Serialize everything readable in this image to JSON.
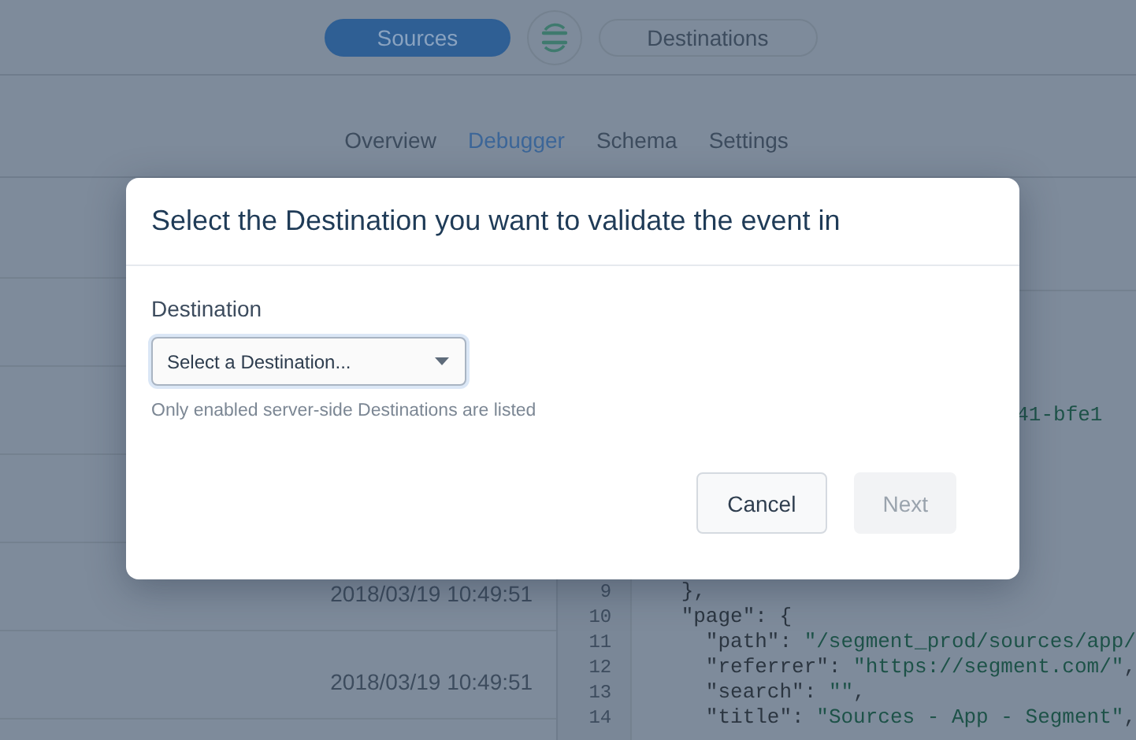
{
  "top_nav": [
    {
      "label": "Sources",
      "selected": true
    },
    {
      "label": "Destinations",
      "selected": false
    }
  ],
  "tabs": [
    {
      "label": "Overview",
      "selected": false
    },
    {
      "label": "Debugger",
      "selected": true
    },
    {
      "label": "Schema",
      "selected": false
    },
    {
      "label": "Settings",
      "selected": false
    }
  ],
  "events": [
    {
      "time": "2018/03/19 10:49:51"
    },
    {
      "time": "2018/03/19 10:49:51"
    }
  ],
  "code": {
    "fragment": "41-bfe1",
    "lines": [
      {
        "number": "9",
        "parts": [
          {
            "kind": "punct",
            "text": "    },"
          }
        ]
      },
      {
        "number": "10",
        "parts": [
          {
            "kind": "key",
            "text": "    \"page\": {"
          }
        ]
      },
      {
        "number": "11",
        "parts": [
          {
            "kind": "key",
            "text": "      \"path\": "
          },
          {
            "kind": "string",
            "text": "\"/segment_prod/sources/app/"
          }
        ]
      },
      {
        "number": "12",
        "parts": [
          {
            "kind": "key",
            "text": "      \"referrer\": "
          },
          {
            "kind": "string",
            "text": "\"https://segment.com/\""
          },
          {
            "kind": "punct",
            "text": ","
          }
        ]
      },
      {
        "number": "13",
        "parts": [
          {
            "kind": "key",
            "text": "      \"search\": "
          },
          {
            "kind": "string",
            "text": "\"\""
          },
          {
            "kind": "punct",
            "text": ","
          }
        ]
      },
      {
        "number": "14",
        "parts": [
          {
            "kind": "key",
            "text": "      \"title\": "
          },
          {
            "kind": "string",
            "text": "\"Sources - App - Segment\""
          },
          {
            "kind": "punct",
            "text": ","
          }
        ]
      }
    ]
  },
  "dialog": {
    "title": "Select the Destination you want to validate the event in",
    "field_label": "Destination",
    "select": {
      "placeholder": "Select a Destination..."
    },
    "help": "Only enabled server-side Destinations are listed",
    "buttons": [
      {
        "label": "Cancel",
        "disabled": false
      },
      {
        "label": "Next",
        "disabled": true
      }
    ]
  }
}
